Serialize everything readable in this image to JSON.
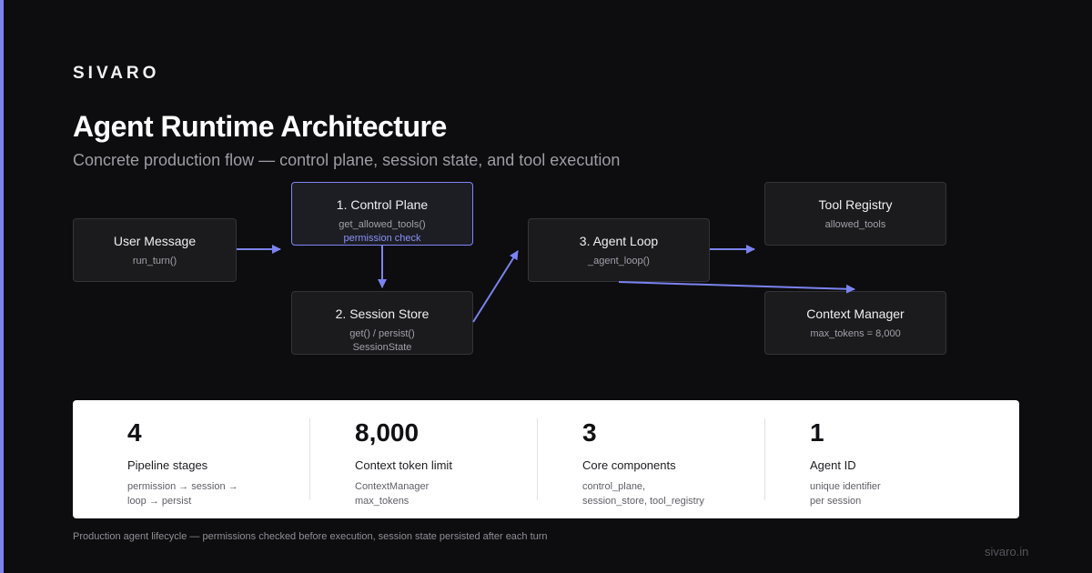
{
  "brand": "SIVARO",
  "title": "Agent Runtime Architecture",
  "subtitle": "Concrete production flow — control plane, session state, and tool execution",
  "nodes": {
    "user_message": {
      "title": "User Message",
      "sub": "run_turn()"
    },
    "control_plane": {
      "title": "1. Control Plane",
      "sub": "get_allowed_tools()",
      "note": "permission check"
    },
    "session_store": {
      "title": "2. Session Store",
      "sub": "get() / persist()",
      "sub2": "SessionState"
    },
    "agent_loop": {
      "title": "3. Agent Loop",
      "sub": "_agent_loop()"
    },
    "tool_registry": {
      "title": "Tool Registry",
      "sub": "allowed_tools"
    },
    "context_manager": {
      "title": "Context Manager",
      "sub": "max_tokens = 8,000"
    }
  },
  "stats": [
    {
      "value": "4",
      "label": "Pipeline stages",
      "desc1": "permission → session →",
      "desc2": "loop → persist"
    },
    {
      "value": "8,000",
      "label": "Context token limit",
      "desc1": "ContextManager",
      "desc2": "max_tokens"
    },
    {
      "value": "3",
      "label": "Core components",
      "desc1": "control_plane,",
      "desc2": "session_store, tool_registry"
    },
    {
      "value": "1",
      "label": "Agent ID",
      "desc1": "unique identifier",
      "desc2": "per session"
    }
  ],
  "footer": {
    "note": "Production agent lifecycle — permissions checked before execution, session state persisted after each turn",
    "url": "sivaro.in"
  },
  "colors": {
    "accent": "#7b83f0",
    "background": "#0d0d0f",
    "node_fill": "#1b1b1e",
    "node_border": "#33333a",
    "stats_card": "#ffffff"
  }
}
